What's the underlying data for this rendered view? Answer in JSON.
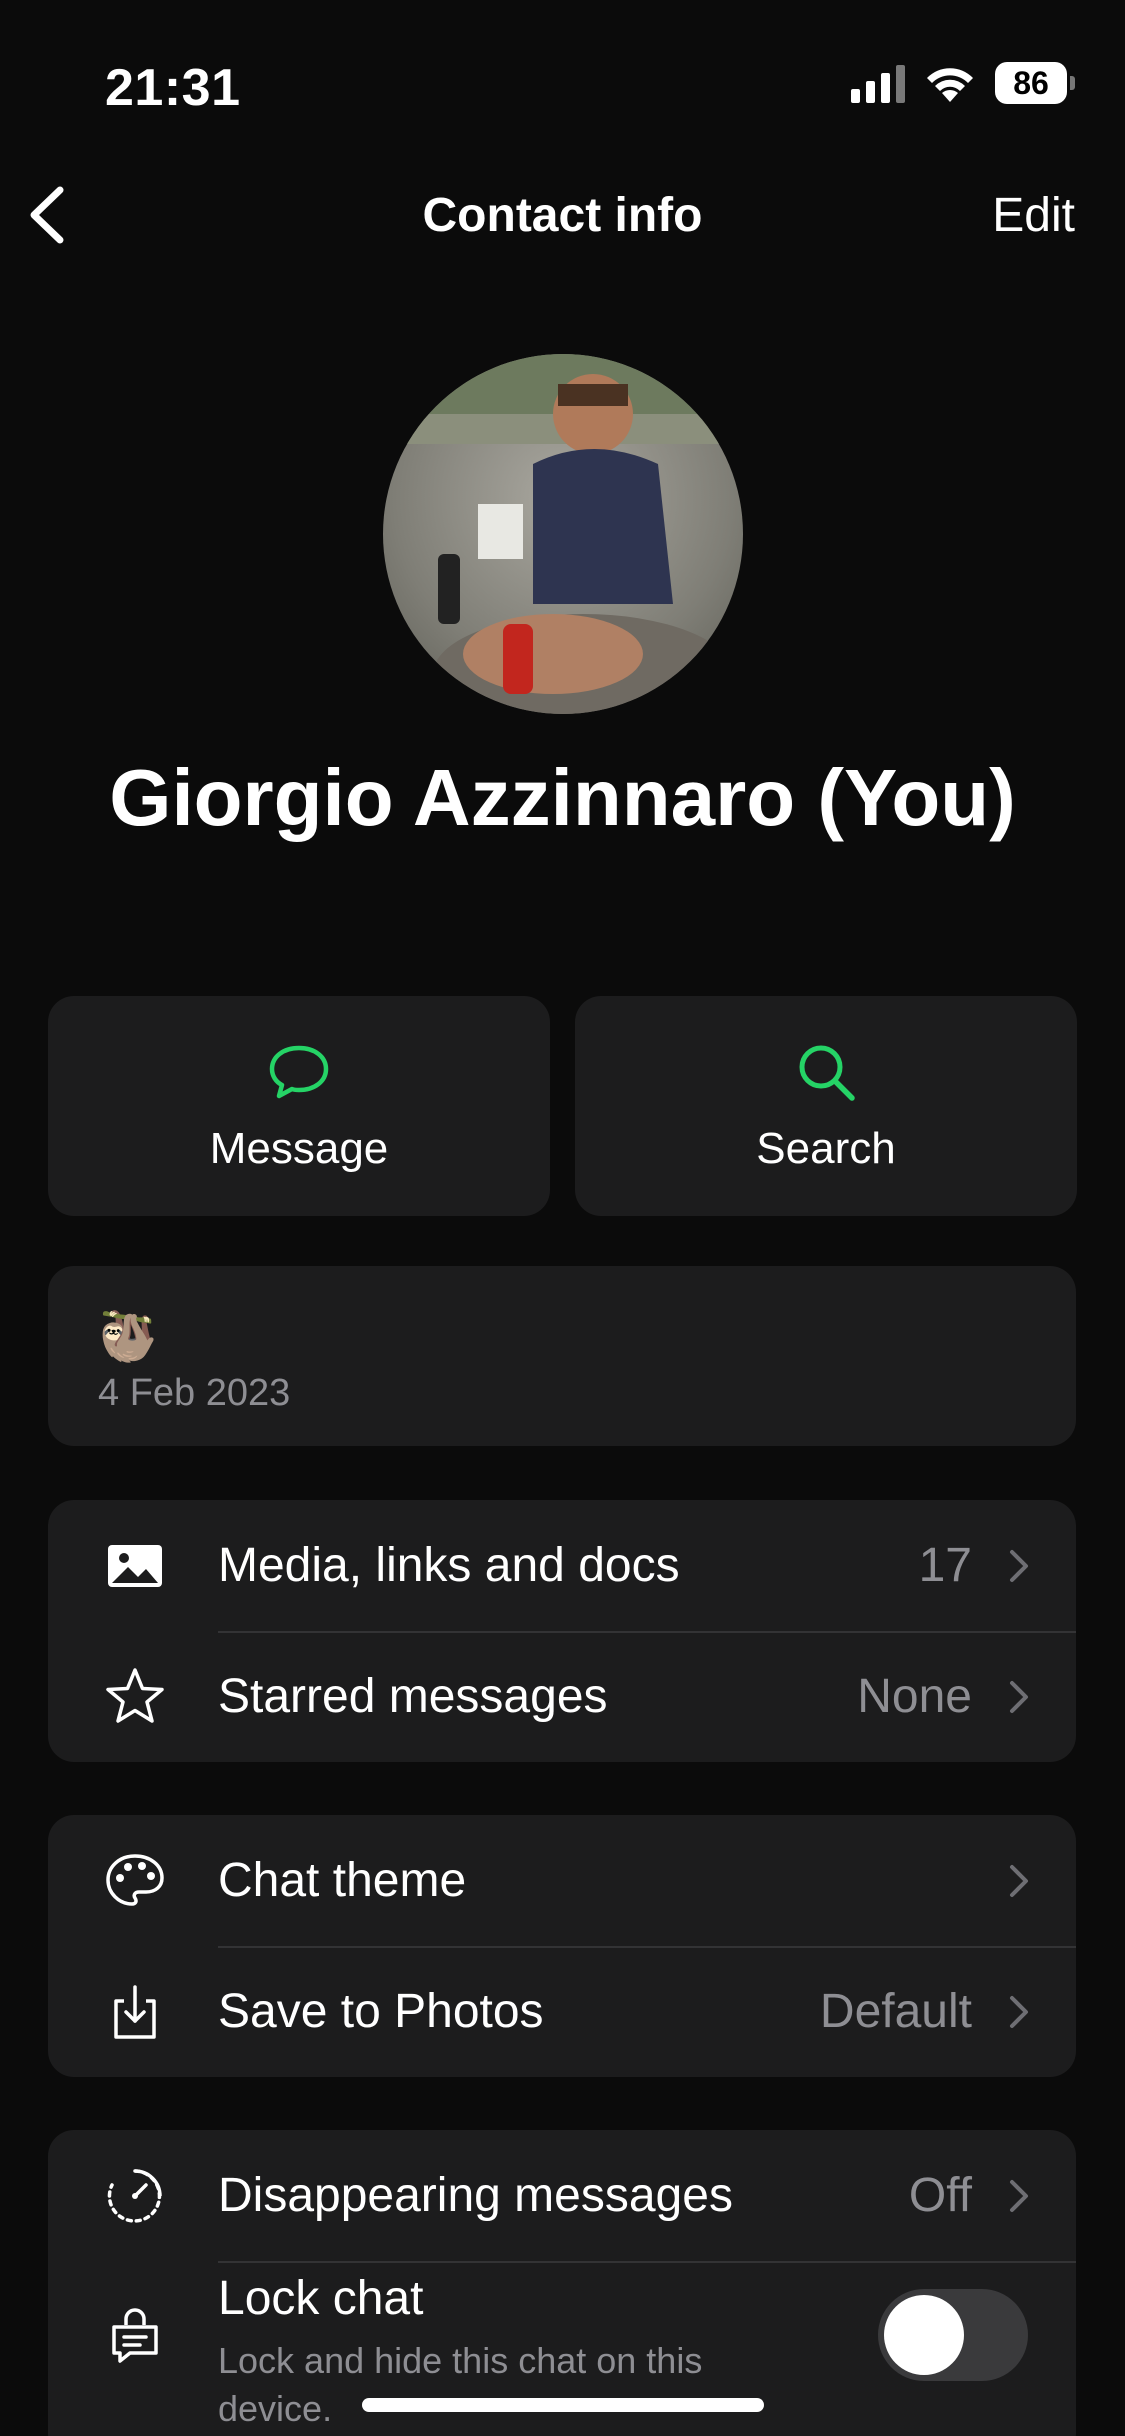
{
  "status_bar": {
    "time": "21:31",
    "battery": "86"
  },
  "nav": {
    "title": "Contact info",
    "edit_label": "Edit"
  },
  "profile": {
    "name": "Giorgio Azzinnaro (You)"
  },
  "actions": {
    "message_label": "Message",
    "search_label": "Search"
  },
  "about": {
    "emoji": "🦥",
    "date": "4 Feb 2023"
  },
  "group1": {
    "media": {
      "label": "Media, links and docs",
      "value": "17"
    },
    "starred": {
      "label": "Starred messages",
      "value": "None"
    }
  },
  "group2": {
    "theme": {
      "label": "Chat theme",
      "value": ""
    },
    "save": {
      "label": "Save to Photos",
      "value": "Default"
    }
  },
  "group3": {
    "disappearing": {
      "label": "Disappearing messages",
      "value": "Off"
    },
    "lock": {
      "label": "Lock chat",
      "sublabel": "Lock and hide this chat on this device."
    }
  },
  "colors": {
    "accent": "#25d366",
    "card": "#1c1c1d",
    "secondary_text": "#8e8e93"
  }
}
